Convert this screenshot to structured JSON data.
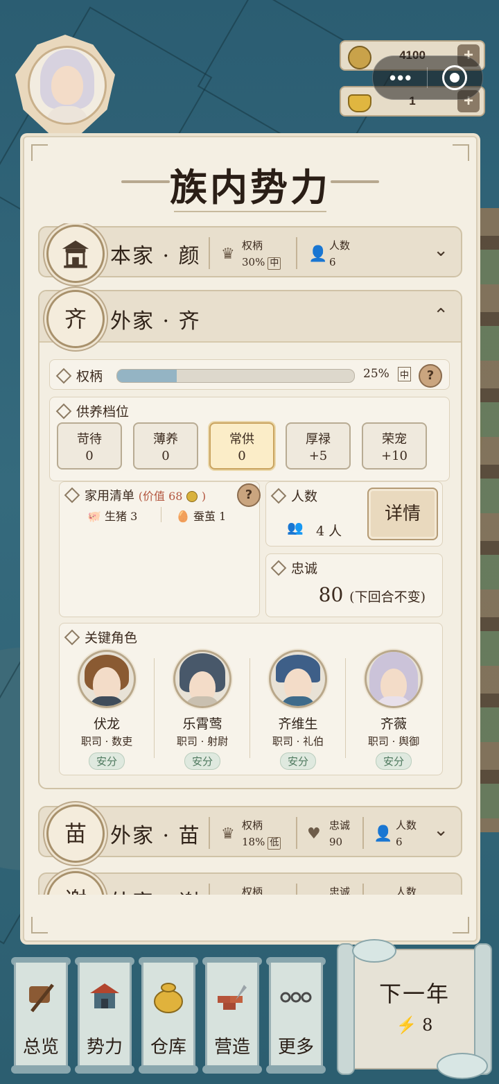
{
  "resources": {
    "coins": "4100",
    "ingots": "1",
    "plus": "+"
  },
  "title": "族内势力",
  "clans": {
    "main": {
      "glyph_icon": "palace-icon",
      "name": "本家 · 颜",
      "power_label": "权柄",
      "power_value": "30%",
      "power_tag": "中",
      "people_label": "人数",
      "people_value": "6"
    },
    "qi": {
      "glyph": "齐",
      "name": "外家 · 齐",
      "power_label": "权柄",
      "power_value": "25%",
      "power_tag": "中",
      "power_fraction": 0.25,
      "support_label": "供养档位",
      "tiers": [
        {
          "name": "苛待",
          "value": "0"
        },
        {
          "name": "薄养",
          "value": "0"
        },
        {
          "name": "常供",
          "value": "0",
          "selected": true
        },
        {
          "name": "厚禄",
          "value": "+5"
        },
        {
          "name": "荣宠",
          "value": "+10"
        }
      ],
      "household_label": "家用清单",
      "household_value": "(价值 68",
      "household_value_end": ")",
      "items": [
        {
          "icon": "pig-icon",
          "text": "生猪 3"
        },
        {
          "icon": "cocoon-icon",
          "text": "蚕茧 1"
        }
      ],
      "people_label": "人数",
      "people_value": "4 人",
      "details_button": "详情",
      "loyalty_label": "忠诚",
      "loyalty_value": "80",
      "loyalty_note": "(下回合不变)",
      "roles_label": "关键角色",
      "roles": [
        {
          "name": "伏龙",
          "job": "职司 · 数吏",
          "status": "安分"
        },
        {
          "name": "乐霄莺",
          "job": "职司 · 射尉",
          "status": "安分"
        },
        {
          "name": "齐维生",
          "job": "职司 · 礼伯",
          "status": "安分"
        },
        {
          "name": "齐薇",
          "job": "职司 · 舆御",
          "status": "安分"
        }
      ]
    },
    "miao": {
      "glyph": "苗",
      "name": "外家 · 苗",
      "power_label": "权柄",
      "power_value": "18%",
      "power_tag": "低",
      "loyalty_label": "忠诚",
      "loyalty_value": "90",
      "people_label": "人数",
      "people_value": "6"
    },
    "partial": {
      "glyph": "谢",
      "name": "外家 · 谢",
      "power_label": "权柄",
      "loyalty_label": "忠诚",
      "people_label": "人数"
    }
  },
  "nav": [
    {
      "label": "总览",
      "icon": "broom-icon"
    },
    {
      "label": "势力",
      "icon": "palace-icon"
    },
    {
      "label": "仓库",
      "icon": "money-bag-icon"
    },
    {
      "label": "营造",
      "icon": "trowel-bricks-icon"
    },
    {
      "label": "更多",
      "icon": "more-dots-icon"
    }
  ],
  "next_year": {
    "label": "下一年",
    "energy": "8"
  },
  "colors": {
    "panel_bg": "#f4efe3",
    "accent_gold": "#c9a35f",
    "power_bar": "#94b4c4",
    "status_green": "#4f7a5f"
  }
}
